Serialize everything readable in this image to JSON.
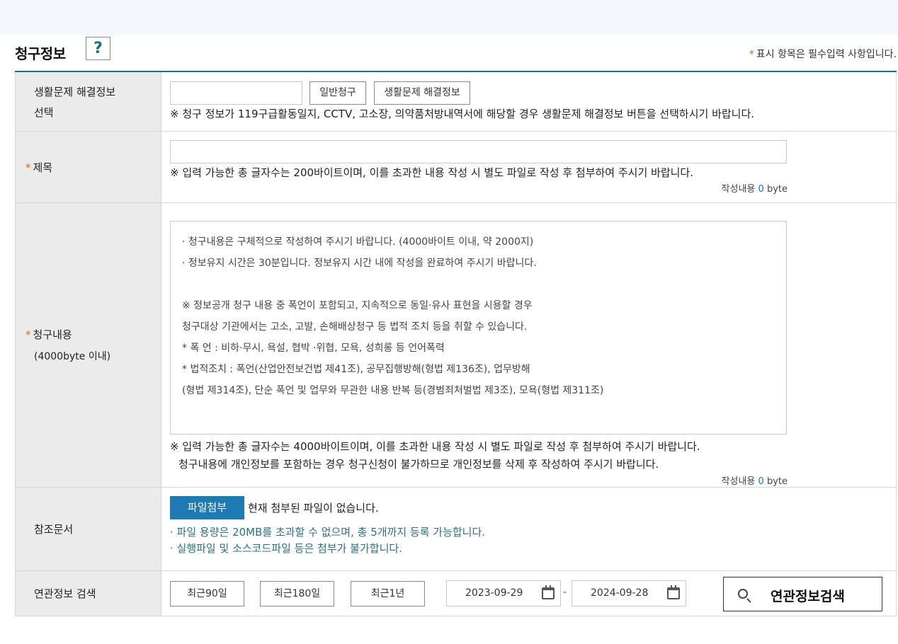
{
  "header": {
    "title": "청구정보",
    "help_label": "?",
    "required_note_star": "*",
    "required_note": "표시 항목은 필수입력 사항입니다."
  },
  "rows": {
    "life_problem": {
      "label_line1": "생활문제 해결정보",
      "label_line2": "선택",
      "input_value": "",
      "general_button": "일반청구",
      "life_button": "생활문제 해결정보",
      "note": "※ 청구 정보가 119구급활동일지, CCTV, 고소장, 의약품처방내역서에 해당할 경우 생활문제 해결정보 버튼을 선택하시기 바랍니다."
    },
    "subject": {
      "star": "*",
      "label": "제목",
      "input_value": "",
      "note": "※ 입력 가능한 총 글자수는 200바이트이며, 이를 초과한 내용 작성 시 별도 파일로 작성 후 첨부하여 주시기 바랍니다.",
      "counter_prefix": "작성내용",
      "counter_value": "0",
      "counter_unit": "byte"
    },
    "content": {
      "star": "*",
      "label": "청구내용",
      "sublabel": "(4000byte 이내)",
      "placeholder_lines": [
        "· 청구내용은 구체적으로 작성하여 주시기 바랍니다. (4000바이트 이내, 약 2000지)",
        "· 정보유지 시간은 30분입니다. 정보유지 시간 내에 작성을 완료하여 주시기 바랍니다.",
        "",
        " ※ 정보공개 청구 내용 중 폭언이 포함되고, 지속적으로 동일·유사 표현을 시용할 경우",
        " 청구대상 기관에서는 고소, 고발, 손해배상청구 등 법적 조치 등을 취할 수 있습니다.",
        "* 폭       언 : 비하·무시, 욕설, 협박 ·위협, 모욕, 성희롱 등 언어폭력",
        "* 법적조치 : 폭언(산업안전보건법 제41조), 공무집행방해(형법 제136조), 업무방해",
        "(형법 제314조), 단순 폭언 및 업무와 무관한 내용 반복 등(경범죄처벌법 제3조), 모욕(형법 제311조)"
      ],
      "note1": "※ 입력 가능한 총 글자수는 4000바이트이며, 이를 초과한 내용 작성 시 별도 파일로 작성 후 첨부하여 주시기 바랍니다.",
      "note2": "청구내용에 개인정보를 포함하는 경우 청구신청이 불가하므로 개인정보를 삭제 후 작성하여 주시기 바랍니다.",
      "counter_prefix": "작성내용",
      "counter_value": "0",
      "counter_unit": "byte"
    },
    "reference": {
      "label": "참조문서",
      "attach_button": "파일첨부",
      "status": "현재 첨부된 파일이 없습니다.",
      "info1": "· 파일 용량은 20MB를 초과할 수 없으며, 총 5개까지 등록 가능합니다.",
      "info2": "· 실행파일 및 소스코드파일 등은 첨부가 불가합니다."
    },
    "related": {
      "label": "연관정보 검색",
      "btn_90": "최근90일",
      "btn_180": "최근180일",
      "btn_1y": "최근1년",
      "date_from": "2023-09-29",
      "date_to": "2024-09-28",
      "separator": "-",
      "search_button": "연관정보검색"
    }
  },
  "colors": {
    "accent": "#1d6e87",
    "button_blue": "#1d7ab5",
    "required_star": "#e8630a",
    "counter_blue": "#1a73c9"
  },
  "icons": {
    "calendar": "calendar-icon",
    "search": "search-icon",
    "help": "help-icon"
  }
}
